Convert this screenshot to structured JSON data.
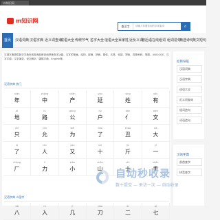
{
  "browser": {
    "tab_title": "m知识网"
  },
  "site": {
    "logo_text": "m知识网",
    "brand_color": "#e02e24",
    "accent_color": "#2a6db5"
  },
  "search": {
    "category": "查汉字",
    "placeholder": "请输入你要查询的字或者词",
    "button_icon": "search-icon"
  },
  "nav": {
    "items": [
      "首页",
      "汉语词典",
      "汉语字典",
      "近义词查询",
      "成语大全",
      "传统节气",
      "名字大全",
      "谜语大全",
      "百家姓",
      "近反义词",
      "歇后语",
      "在线组词",
      "组词造句",
      "精选诗句",
      "英文短句"
    ],
    "active_index": 0
  },
  "intro": "汉语字典提供新华字典在线查询部首查询拼音查字功能，汉字的笔画、结构、部首、拼音、繁体、五笔、仓颉、郑码、四角号码、笔顺、UNICODE、汉字字源、汉字演变、说文解字、康熙字典、English等。",
  "sections": [
    {
      "title": "汉语字典 热门",
      "cells": [
        {
          "py": "nián",
          "hz": "年"
        },
        {
          "py": "zhōng",
          "hz": "中"
        },
        {
          "py": "chǎn",
          "hz": "产"
        },
        {
          "py": "yán",
          "hz": "延"
        },
        {
          "py": "xìng",
          "hz": "姓"
        },
        {
          "py": "yǒu",
          "hz": "有"
        },
        {
          "py": "dì",
          "hz": "地"
        },
        {
          "py": "lù",
          "hz": "路"
        },
        {
          "py": "gōng",
          "hz": "公"
        },
        {
          "py": "hù",
          "hz": "户"
        },
        {
          "py": "dǎn",
          "hz": "亻"
        },
        {
          "py": "wén",
          "hz": "文"
        },
        {
          "py": "zhǐ",
          "hz": "只"
        },
        {
          "py": "yǔn",
          "hz": "允"
        },
        {
          "py": "wéi",
          "hz": "为"
        },
        {
          "py": "liǎo",
          "hz": "了"
        },
        {
          "py": "chóu",
          "hz": "丑"
        },
        {
          "py": "dà",
          "hz": "大"
        },
        {
          "py": "le",
          "hz": "了"
        },
        {
          "py": "rén",
          "hz": "人"
        },
        {
          "py": "yòu",
          "hz": "又"
        },
        {
          "py": "shí",
          "hz": "十"
        },
        {
          "py": "jīn",
          "hz": "斤"
        },
        {
          "py": "yī",
          "hz": "一"
        },
        {
          "py": "chǎng",
          "hz": "厂"
        },
        {
          "py": "lì",
          "hz": "力"
        },
        {
          "py": "xiǎo",
          "hz": "小"
        },
        {
          "py": "shān",
          "hz": "山"
        },
        {
          "py": "shì",
          "hz": "士"
        },
        {
          "py": "shǒu",
          "hz": "手"
        }
      ]
    },
    {
      "title": "汉语字典 二画字",
      "cells": [
        {
          "py": "bā",
          "hz": "八"
        },
        {
          "py": "rù",
          "hz": "入"
        },
        {
          "py": "jǐ",
          "hz": "几"
        },
        {
          "py": "dāo",
          "hz": "刀"
        },
        {
          "py": "èr",
          "hz": "二"
        },
        {
          "py": "qī",
          "hz": "七"
        }
      ]
    }
  ],
  "sidebar": {
    "title": "栏目导航",
    "links": [
      "汉语词典",
      "汉语字典",
      "成语大全",
      "近义词查询",
      "组词造句",
      "词语造句"
    ],
    "title2": "汉语字典",
    "links2": [
      "部首查字",
      "拼音查字"
    ]
  },
  "watermark": {
    "main": "自动秒收录",
    "sub": "数十提交 — 来访一次 — 自动收录"
  }
}
